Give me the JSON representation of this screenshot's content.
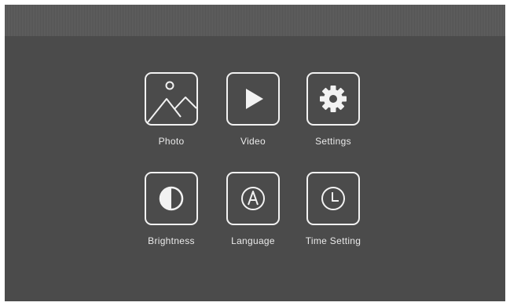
{
  "menu": {
    "items": [
      {
        "label": "Photo",
        "icon": "photo-icon"
      },
      {
        "label": "Video",
        "icon": "play-icon"
      },
      {
        "label": "Settings",
        "icon": "gear-icon"
      },
      {
        "label": "Brightness",
        "icon": "brightness-icon"
      },
      {
        "label": "Language",
        "icon": "language-icon"
      },
      {
        "label": "Time Setting",
        "icon": "clock-icon"
      }
    ]
  },
  "colors": {
    "background": "#4b4b4b",
    "topbar": "#5a5a5a",
    "icon": "#f2f2f2",
    "text": "#eaeaea"
  }
}
